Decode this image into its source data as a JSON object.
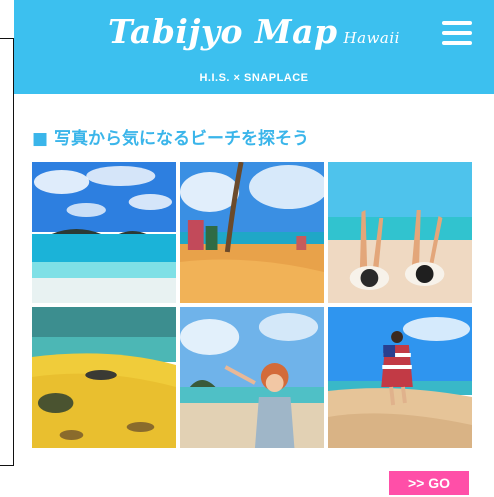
{
  "header": {
    "logo_main": "Tabijyo Map",
    "logo_sub": "Hawaii",
    "tagline": "H.I.S. × SNAPLACE",
    "menu_icon": "hamburger-menu-icon"
  },
  "section": {
    "title": "■ 写真から気になるビーチを探そう",
    "go_label": ">> GO"
  },
  "colors": {
    "header_bg": "#3cc0ef",
    "title": "#3ab5ea",
    "go_button": "#ff4fa8"
  }
}
